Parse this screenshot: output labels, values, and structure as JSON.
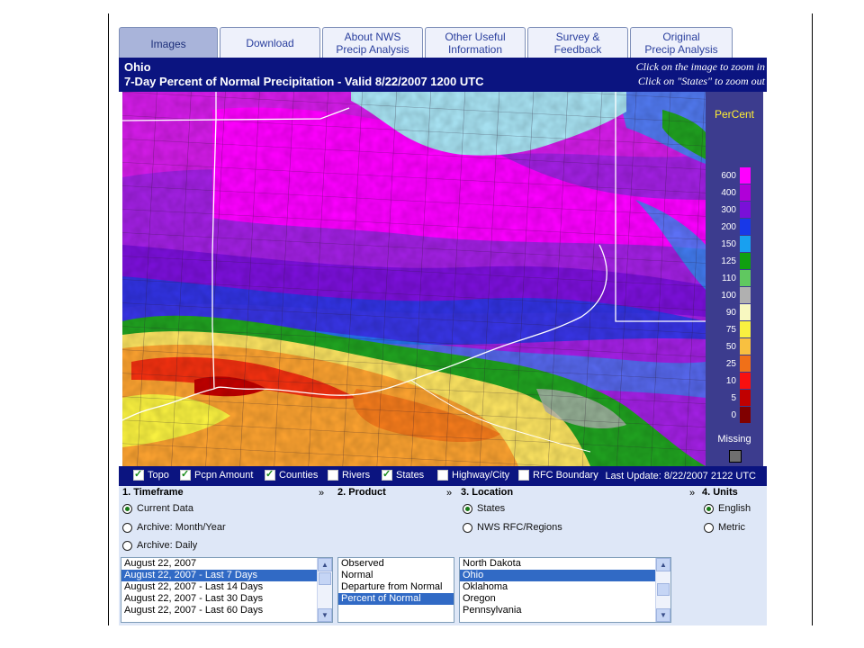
{
  "tabs": [
    {
      "label": "Images",
      "active": true
    },
    {
      "label": "Download",
      "active": false
    },
    {
      "label": "About NWS\nPrecip Analysis",
      "active": false
    },
    {
      "label": "Other Useful\nInformation",
      "active": false
    },
    {
      "label": "Survey &\nFeedback",
      "active": false
    },
    {
      "label": "Original\nPrecip Analysis",
      "active": false
    }
  ],
  "header": {
    "location": "Ohio",
    "title": "7-Day Percent of Normal Precipitation - Valid 8/22/2007 1200 UTC",
    "hint_zoom_in": "Click on the image to zoom in",
    "hint_zoom_out": "Click on \"States\" to zoom out"
  },
  "legend": {
    "title": "PerCent",
    "missing_label": "Missing",
    "items": [
      {
        "value": "600",
        "color": "#ff00ff"
      },
      {
        "value": "400",
        "color": "#b000d8"
      },
      {
        "value": "300",
        "color": "#7a10d8"
      },
      {
        "value": "200",
        "color": "#1838e8"
      },
      {
        "value": "150",
        "color": "#18a0f0"
      },
      {
        "value": "125",
        "color": "#10a010"
      },
      {
        "value": "110",
        "color": "#60c860"
      },
      {
        "value": "100",
        "color": "#b0b0b0"
      },
      {
        "value": "90",
        "color": "#f8f8c0"
      },
      {
        "value": "75",
        "color": "#f8f040"
      },
      {
        "value": "50",
        "color": "#f8c040"
      },
      {
        "value": "25",
        "color": "#f07018"
      },
      {
        "value": "10",
        "color": "#f81010"
      },
      {
        "value": "5",
        "color": "#c00000"
      },
      {
        "value": "0",
        "color": "#800000"
      }
    ]
  },
  "options": [
    {
      "label": "Topo",
      "checked": true
    },
    {
      "label": "Pcpn Amount",
      "checked": true
    },
    {
      "label": "Counties",
      "checked": true
    },
    {
      "label": "Rivers",
      "checked": false
    },
    {
      "label": "States",
      "checked": true
    },
    {
      "label": "Highway/City",
      "checked": false
    },
    {
      "label": "RFC Boundary",
      "checked": false
    }
  ],
  "last_update": "Last Update: 8/22/2007 2122 UTC",
  "sections": {
    "timeframe": "1. Timeframe",
    "product": "2. Product",
    "location": "3. Location",
    "units": "4. Units",
    "arrow": "»"
  },
  "timeframe_radios": [
    {
      "label": "Current Data",
      "checked": true
    },
    {
      "label": "Archive: Month/Year",
      "checked": false
    },
    {
      "label": "Archive: Daily",
      "checked": false
    }
  ],
  "location_radios": [
    {
      "label": "States",
      "checked": true
    },
    {
      "label": "NWS RFC/Regions",
      "checked": false
    }
  ],
  "units_radios": [
    {
      "label": "English",
      "checked": true
    },
    {
      "label": "Metric",
      "checked": false
    }
  ],
  "timeframe_list": [
    {
      "label": "August 22, 2007",
      "selected": false
    },
    {
      "label": "August 22, 2007 - Last 7 Days",
      "selected": true
    },
    {
      "label": "August 22, 2007 - Last 14 Days",
      "selected": false
    },
    {
      "label": "August 22, 2007 - Last 30 Days",
      "selected": false
    },
    {
      "label": "August 22, 2007 - Last 60 Days",
      "selected": false
    }
  ],
  "product_list": [
    {
      "label": "Observed",
      "selected": false
    },
    {
      "label": "Normal",
      "selected": false
    },
    {
      "label": "Departure from Normal",
      "selected": false
    },
    {
      "label": "Percent of Normal",
      "selected": true
    }
  ],
  "location_list": [
    {
      "label": "North Dakota",
      "selected": false
    },
    {
      "label": "Ohio",
      "selected": true
    },
    {
      "label": "Oklahoma",
      "selected": false
    },
    {
      "label": "Oregon",
      "selected": false
    },
    {
      "label": "Pennsylvania",
      "selected": false
    }
  ]
}
